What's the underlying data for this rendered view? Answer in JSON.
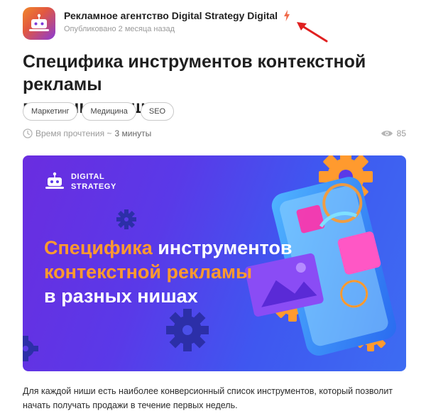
{
  "author": {
    "name": "Рекламное агентство Digital Strategy Digital",
    "published": "Опубликовано 2 месяца назад"
  },
  "article": {
    "title_line1": "Специфика инструментов контекстной рекламы",
    "title_line2": "в разных нишах",
    "tags": [
      "Маркетинг",
      "Медицина",
      "SEO"
    ],
    "read_time_label": "Время прочтения ~",
    "read_time_value": "3 минуты",
    "views": "85",
    "excerpt": "Для каждой ниши есть наиболее конверсионный список инструментов, который позволит начать получать продажи в течение первых недель."
  },
  "banner": {
    "brand_line1": "DIGITAL",
    "brand_line2": "STRATEGY",
    "headline_line1_accent": "Специфика",
    "headline_line1_rest": " инструментов",
    "headline_line2": "контекстной рекламы",
    "headline_line3": "в разных нишах"
  },
  "colors": {
    "accent_orange": "#ff9a2e",
    "annotation_red": "#e02020",
    "banner_purple": "#6a2de0",
    "banner_blue": "#3d6cf2"
  },
  "icons": {
    "bolt": "bolt-icon",
    "clock": "clock-icon",
    "eye": "eye-icon"
  }
}
